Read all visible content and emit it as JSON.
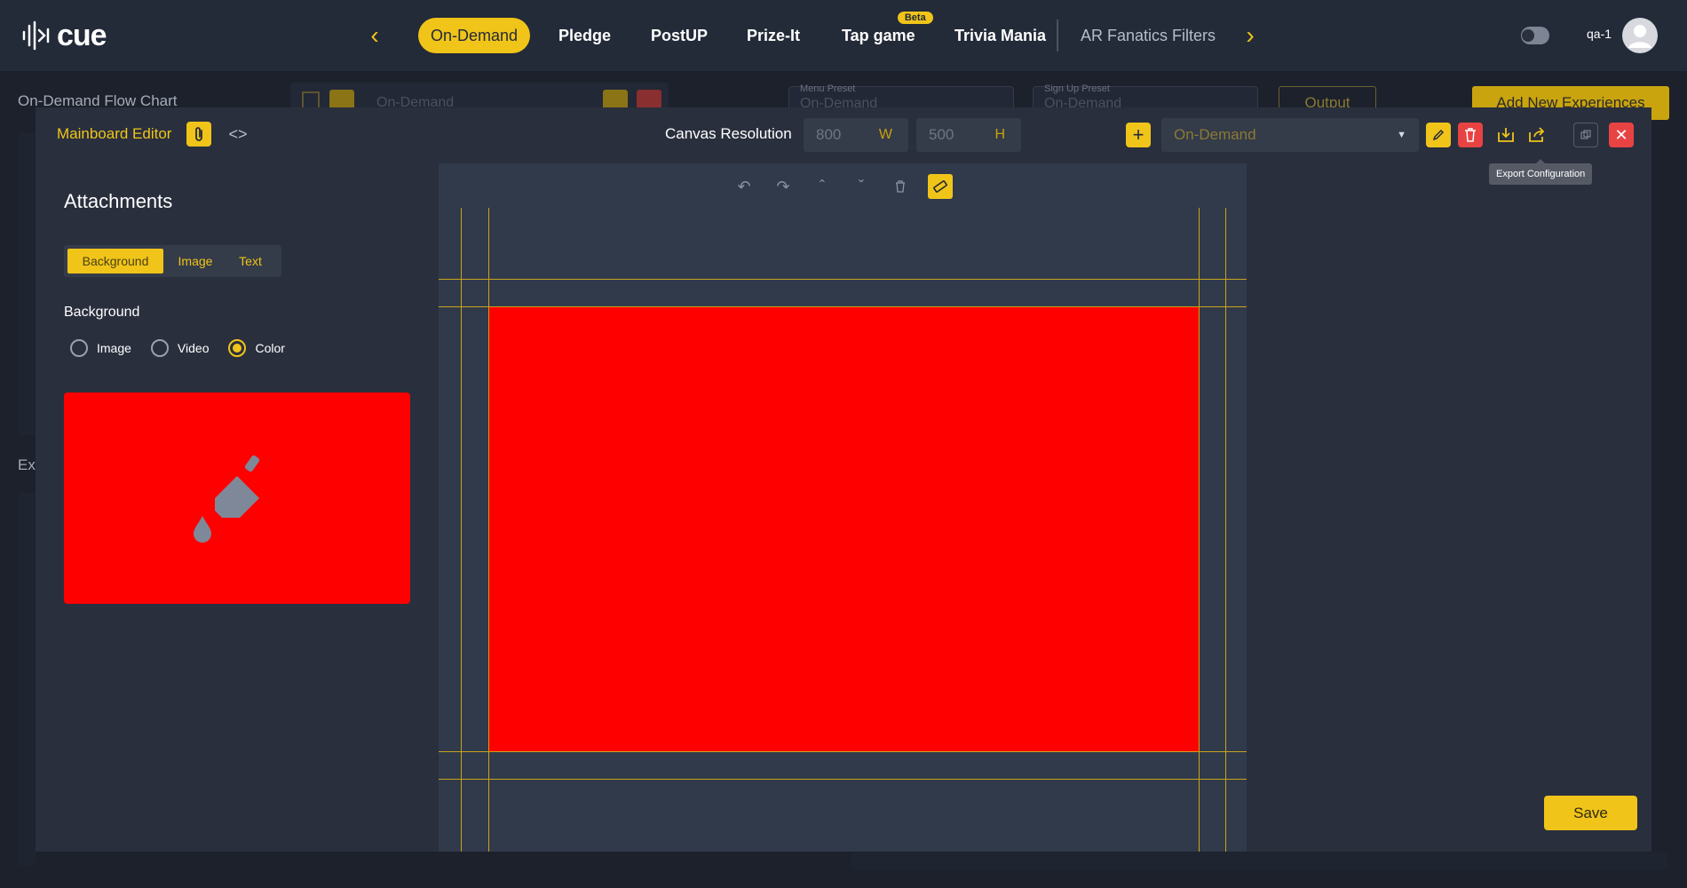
{
  "brand": {
    "logo_text": "cue"
  },
  "nav": {
    "tabs": [
      {
        "label": "On-Demand"
      },
      {
        "label": "Pledge"
      },
      {
        "label": "PostUP"
      },
      {
        "label": "Prize-It"
      },
      {
        "label": "Tap game",
        "badge": "Beta"
      },
      {
        "label": "Trivia Mania"
      },
      {
        "label": "AR Fanatics Filters"
      }
    ],
    "prev_icon": "chevron-left-icon",
    "next_icon": "chevron-right-icon"
  },
  "user": {
    "name": "qa-1"
  },
  "background_page": {
    "title": "On-Demand Flow Chart",
    "flow_select": "On-Demand",
    "menu_preset_label": "Menu Preset",
    "menu_preset_value": "On-Demand",
    "signup_preset_label": "Sign Up Preset",
    "signup_preset_value": "On-Demand",
    "output_label": "Output",
    "add_button": "Add New Experiences",
    "partial_label": "Exp"
  },
  "modal": {
    "title": "Mainboard Editor",
    "canvas_resolution_label": "Canvas Resolution",
    "width_value": "800",
    "width_unit": "W",
    "height_value": "500",
    "height_unit": "H",
    "preset_value": "On-Demand",
    "tooltip": "Export Configuration",
    "save_label": "Save"
  },
  "attachments": {
    "title": "Attachments",
    "tabs": [
      "Background",
      "Image",
      "Text"
    ],
    "active_tab": "Background",
    "background_label": "Background",
    "options": [
      "Image",
      "Video",
      "Color"
    ],
    "selected_option": "Color",
    "selected_color": "#ff0000"
  },
  "colors": {
    "accent": "#f0c419",
    "danger": "#e84343",
    "canvas_fill": "#ff0000",
    "nav_bg": "#232a38",
    "modal_bg": "#292f3d"
  }
}
